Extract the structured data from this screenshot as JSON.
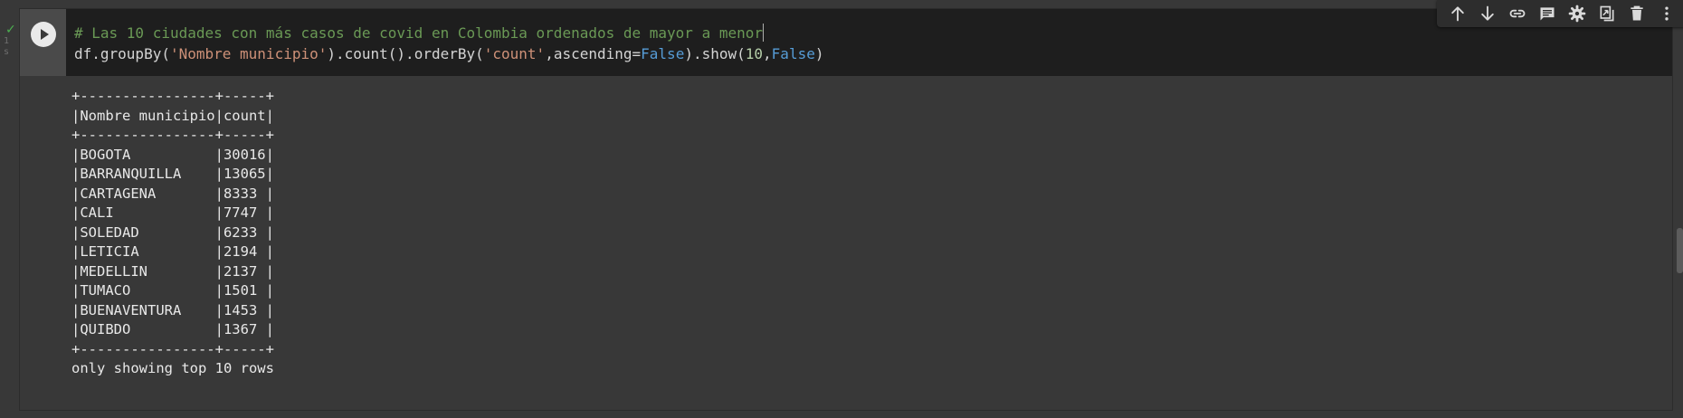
{
  "cell": {
    "status_icon": "check-icon",
    "exec_time": "1 s",
    "run_icon": "play-icon",
    "code": {
      "comment": "# Las 10 ciudades con más casos de covid en Colombia ordenados de mayor a menor",
      "line2": {
        "p1": "df.groupBy(",
        "s1": "'Nombre municipio'",
        "p2": ").count().orderBy(",
        "s2": "'count'",
        "p3": ",ascending=",
        "k1": "False",
        "p4": ").show(",
        "n1": "10",
        "p5": ",",
        "k2": "False",
        "p6": ")"
      }
    },
    "toolbar": [
      {
        "name": "move-up-icon"
      },
      {
        "name": "move-down-icon"
      },
      {
        "name": "link-icon"
      },
      {
        "name": "comment-icon"
      },
      {
        "name": "gear-icon"
      },
      {
        "name": "mirror-cell-icon"
      },
      {
        "name": "trash-icon"
      },
      {
        "name": "more-vert-icon"
      }
    ],
    "output": {
      "lines": [
        "+----------------+-----+",
        "|Nombre municipio|count|",
        "+----------------+-----+",
        "|BOGOTA          |30016|",
        "|BARRANQUILLA    |13065|",
        "|CARTAGENA       |8333 |",
        "|CALI            |7747 |",
        "|SOLEDAD         |6233 |",
        "|LETICIA         |2194 |",
        "|MEDELLIN        |2137 |",
        "|TUMACO          |1501 |",
        "|BUENAVENTURA    |1453 |",
        "|QUIBDO          |1367 |",
        "+----------------+-----+",
        "only showing top 10 rows"
      ]
    }
  },
  "colors": {
    "background": "#383838",
    "code_bg": "#1e1e1e",
    "comment": "#6a9955",
    "string": "#ce9178",
    "keyword": "#569cd6",
    "number": "#b5cea8",
    "success": "#4caf50"
  }
}
